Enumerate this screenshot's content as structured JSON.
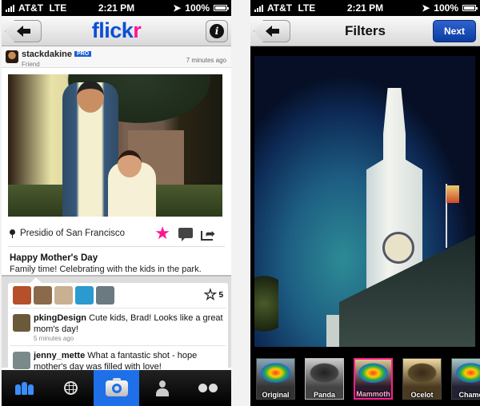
{
  "status_bar": {
    "carrier": "AT&T",
    "network": "LTE",
    "time": "2:21 PM",
    "battery": "100%"
  },
  "left_screen": {
    "logo": {
      "part1": "flick",
      "part2": "r"
    },
    "post": {
      "username": "stackdakine",
      "badge": "PRO",
      "relationship": "Friend",
      "time_ago": "7 minutes ago",
      "location": "Presidio of San Francisco",
      "title": "Happy Mother's Day",
      "description": "Family time! Celebrating with the kids in the park."
    },
    "faves": {
      "count": "5",
      "avatar_colors": [
        "#b5502a",
        "#8a6a4a",
        "#c8b090",
        "#2a9ad0",
        "#6b7a80"
      ]
    },
    "comments": [
      {
        "user": "pkingDesign",
        "text": "Cute kids, Brad! Looks like a great mom's day!",
        "time": "5 minutes ago",
        "avatar_color": "#6a5a3a"
      },
      {
        "user": "jenny_mette",
        "text": "What a fantastic shot - hope mother's day was filled with love!",
        "time": "",
        "avatar_color": "#7a8a8a"
      }
    ],
    "tabbar": [
      {
        "name": "contacts",
        "icon": "people-icon",
        "active": false
      },
      {
        "name": "explore",
        "icon": "globe-icon",
        "active": false
      },
      {
        "name": "camera",
        "icon": "camera-icon",
        "active": true
      },
      {
        "name": "you",
        "icon": "person-icon",
        "active": false
      },
      {
        "name": "flickr",
        "icon": "dots-icon",
        "active": false
      }
    ]
  },
  "right_screen": {
    "title": "Filters",
    "next_label": "Next",
    "filters": [
      {
        "label": "Original",
        "selected": false
      },
      {
        "label": "Panda",
        "selected": false
      },
      {
        "label": "Mammoth",
        "selected": true
      },
      {
        "label": "Ocelot",
        "selected": false
      },
      {
        "label": "Chame",
        "selected": false
      }
    ]
  },
  "colors": {
    "accent_pink": "#ff1493",
    "flickr_blue": "#0a4fd6",
    "tab_active": "#1f6fe8",
    "next_button": "#0b3ca0"
  }
}
